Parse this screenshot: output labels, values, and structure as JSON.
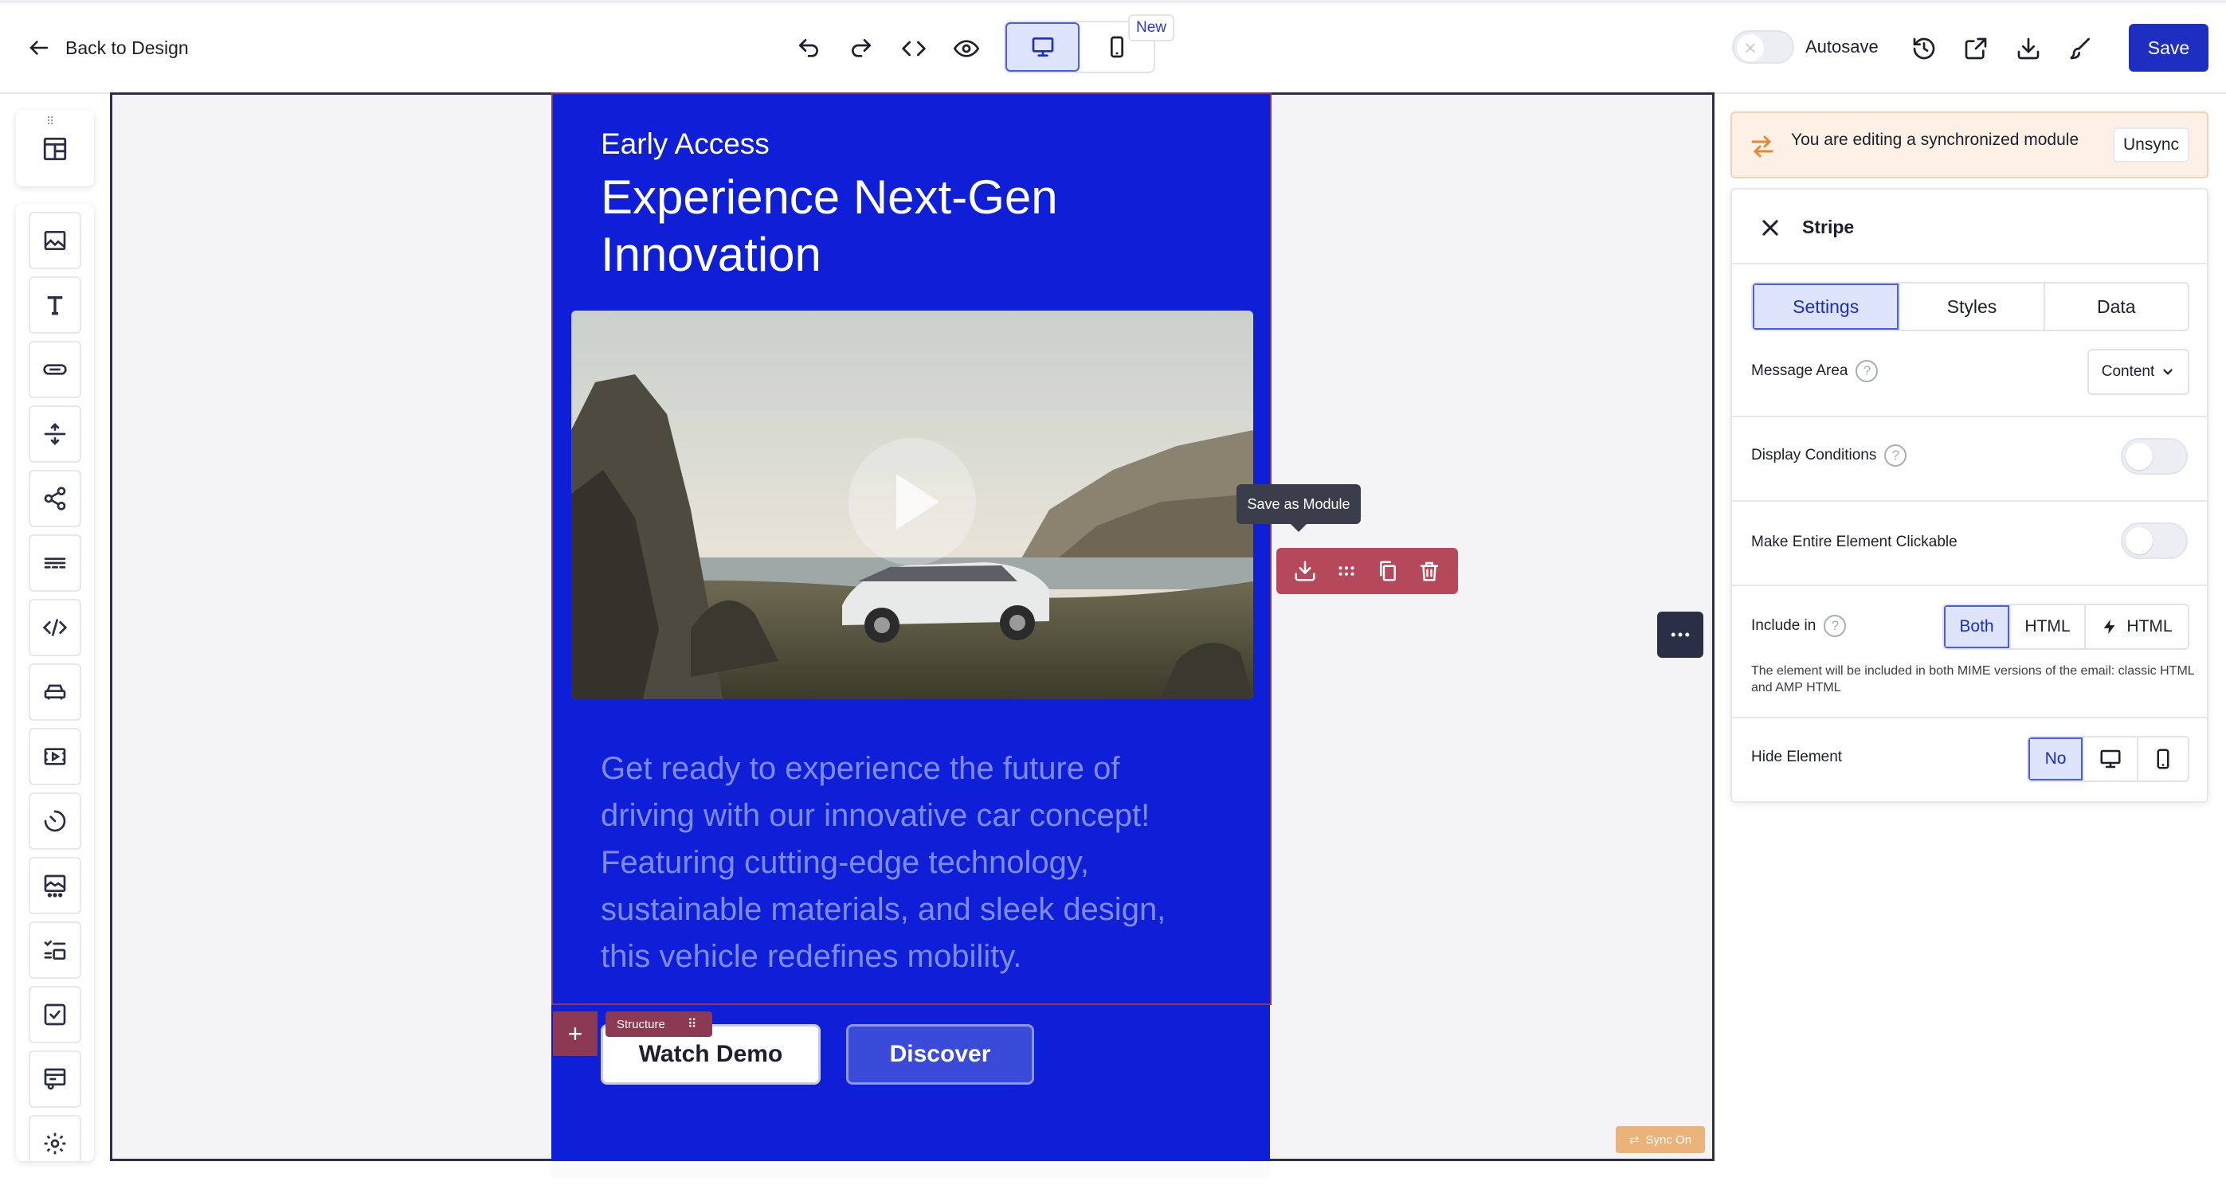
{
  "topbar": {
    "back_label": "Back to Design",
    "new_badge": "New",
    "autosave_label": "Autosave",
    "save_label": "Save"
  },
  "canvas": {
    "eyebrow": "Early Access",
    "headline": "Experience Next-Gen Innovation",
    "body": "Get ready to experience the future of driving with our innovative car concept! Featuring cutting-edge technology, sustainable materials, and sleek design, this vehicle redefines mobility.",
    "cta_primary": "Watch Demo",
    "cta_secondary": "Discover",
    "structure_tag": "Structure",
    "tooltip": "Save as Module",
    "sync_badge": "Sync On",
    "stripe_color": "#0f1fd8"
  },
  "right_panel": {
    "sync_banner_text": "You are editing a synchronized module",
    "unsync_label": "Unsync",
    "title": "Stripe",
    "tabs": [
      "Settings",
      "Styles",
      "Data"
    ],
    "active_tab": "Settings",
    "message_area_label": "Message Area",
    "message_area_value": "Content",
    "display_conditions_label": "Display Conditions",
    "clickable_label": "Make Entire Element Clickable",
    "include_label": "Include in",
    "include_options": [
      "Both",
      "HTML",
      "HTML"
    ],
    "include_note": "The element will be included in both MIME versions of the email: classic HTML and AMP HTML",
    "hide_label": "Hide Element",
    "hide_options": [
      "No"
    ],
    "accent_color": "#1d2ec1"
  },
  "icons": {
    "sidebar": [
      "structures-icon",
      "image-icon",
      "text-icon",
      "button-icon",
      "spacer-icon",
      "social-icon",
      "divider-icon",
      "html-icon",
      "menu-icon",
      "video-icon",
      "timer-icon",
      "banner-icon",
      "checklist-icon",
      "checkbox-icon",
      "card-icon",
      "settings-icon"
    ]
  }
}
